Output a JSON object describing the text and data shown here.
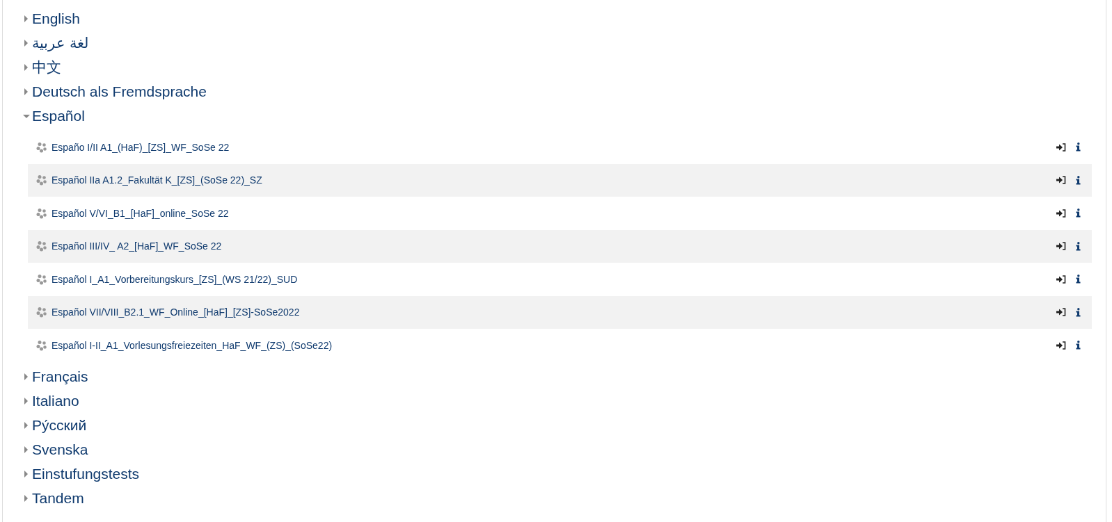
{
  "categories": [
    {
      "name": "English",
      "expanded": false
    },
    {
      "name": "لغة عربية",
      "expanded": false
    },
    {
      "name": "中文",
      "expanded": false
    },
    {
      "name": "Deutsch als Fremdsprache",
      "expanded": false
    },
    {
      "name": "Español",
      "expanded": true,
      "courses": [
        {
          "name": "Españo I/II A1_(HaF)_[ZS]_WF_SoSe 22"
        },
        {
          "name": "Español IIa A1.2_Fakultät K_[ZS]_(SoSe 22)_SZ"
        },
        {
          "name": "Español V/VI_B1_[HaF]_online_SoSe 22"
        },
        {
          "name": "Español III/IV_ A2_[HaF]_WF_SoSe 22"
        },
        {
          "name": "Español I_A1_Vorbereitungskurs_[ZS]_(WS 21/22)_SUD"
        },
        {
          "name": "Español VII/VIII_B2.1_WF_Online_[HaF]_[ZS]-SoSe2022"
        },
        {
          "name": "Español I-II_A1_Vorlesungsfreiezeiten_HaF_WF_(ZS)_(SoSe22)"
        }
      ]
    },
    {
      "name": "Français",
      "expanded": false
    },
    {
      "name": "Italiano",
      "expanded": false
    },
    {
      "name": "Ру́сский",
      "expanded": false
    },
    {
      "name": "Svenska",
      "expanded": false
    },
    {
      "name": "Einstufungstests",
      "expanded": false
    },
    {
      "name": "Tandem",
      "expanded": false
    }
  ]
}
